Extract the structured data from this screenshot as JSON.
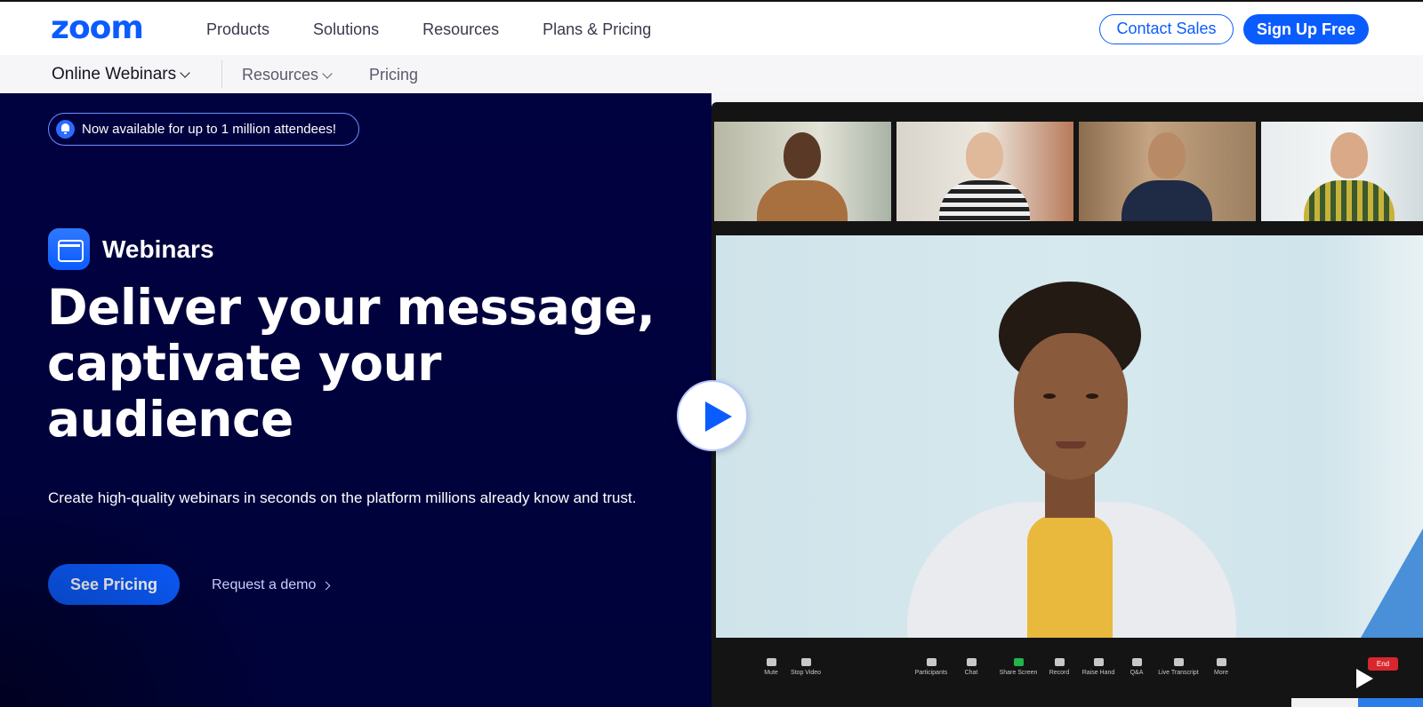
{
  "topnav": {
    "logo": "zoom",
    "links": [
      "Products",
      "Solutions",
      "Resources",
      "Plans & Pricing"
    ],
    "contact_sales": "Contact Sales",
    "sign_up": "Sign Up Free"
  },
  "subnav": {
    "product": "Online Webinars",
    "resources": "Resources",
    "pricing": "Pricing"
  },
  "hero": {
    "announcement": "Now available for up to 1 million attendees!",
    "product_name": "Webinars",
    "headline_1": "Deliver your message,",
    "headline_2": "captivate your",
    "headline_3": "audience",
    "subtext": "Create high-quality webinars in seconds on the platform millions already know and trust.",
    "cta_primary": "See Pricing",
    "cta_secondary": "Request a demo"
  },
  "video": {
    "toolbar": {
      "mute": "Mute",
      "stop_video": "Stop Video",
      "participants": "Participants",
      "chat": "Chat",
      "share_screen": "Share Screen",
      "record": "Record",
      "raise_hand": "Raise Hand",
      "qa": "Q&A",
      "live_transcript": "Live Transcript",
      "more": "More",
      "end": "End"
    }
  },
  "colors": {
    "brand": "#0b5cff",
    "hero_bg": "#00013f"
  },
  "icons": [
    "bell-icon",
    "webinar-icon",
    "chevron-down-icon",
    "chevron-right-icon",
    "play-icon"
  ]
}
